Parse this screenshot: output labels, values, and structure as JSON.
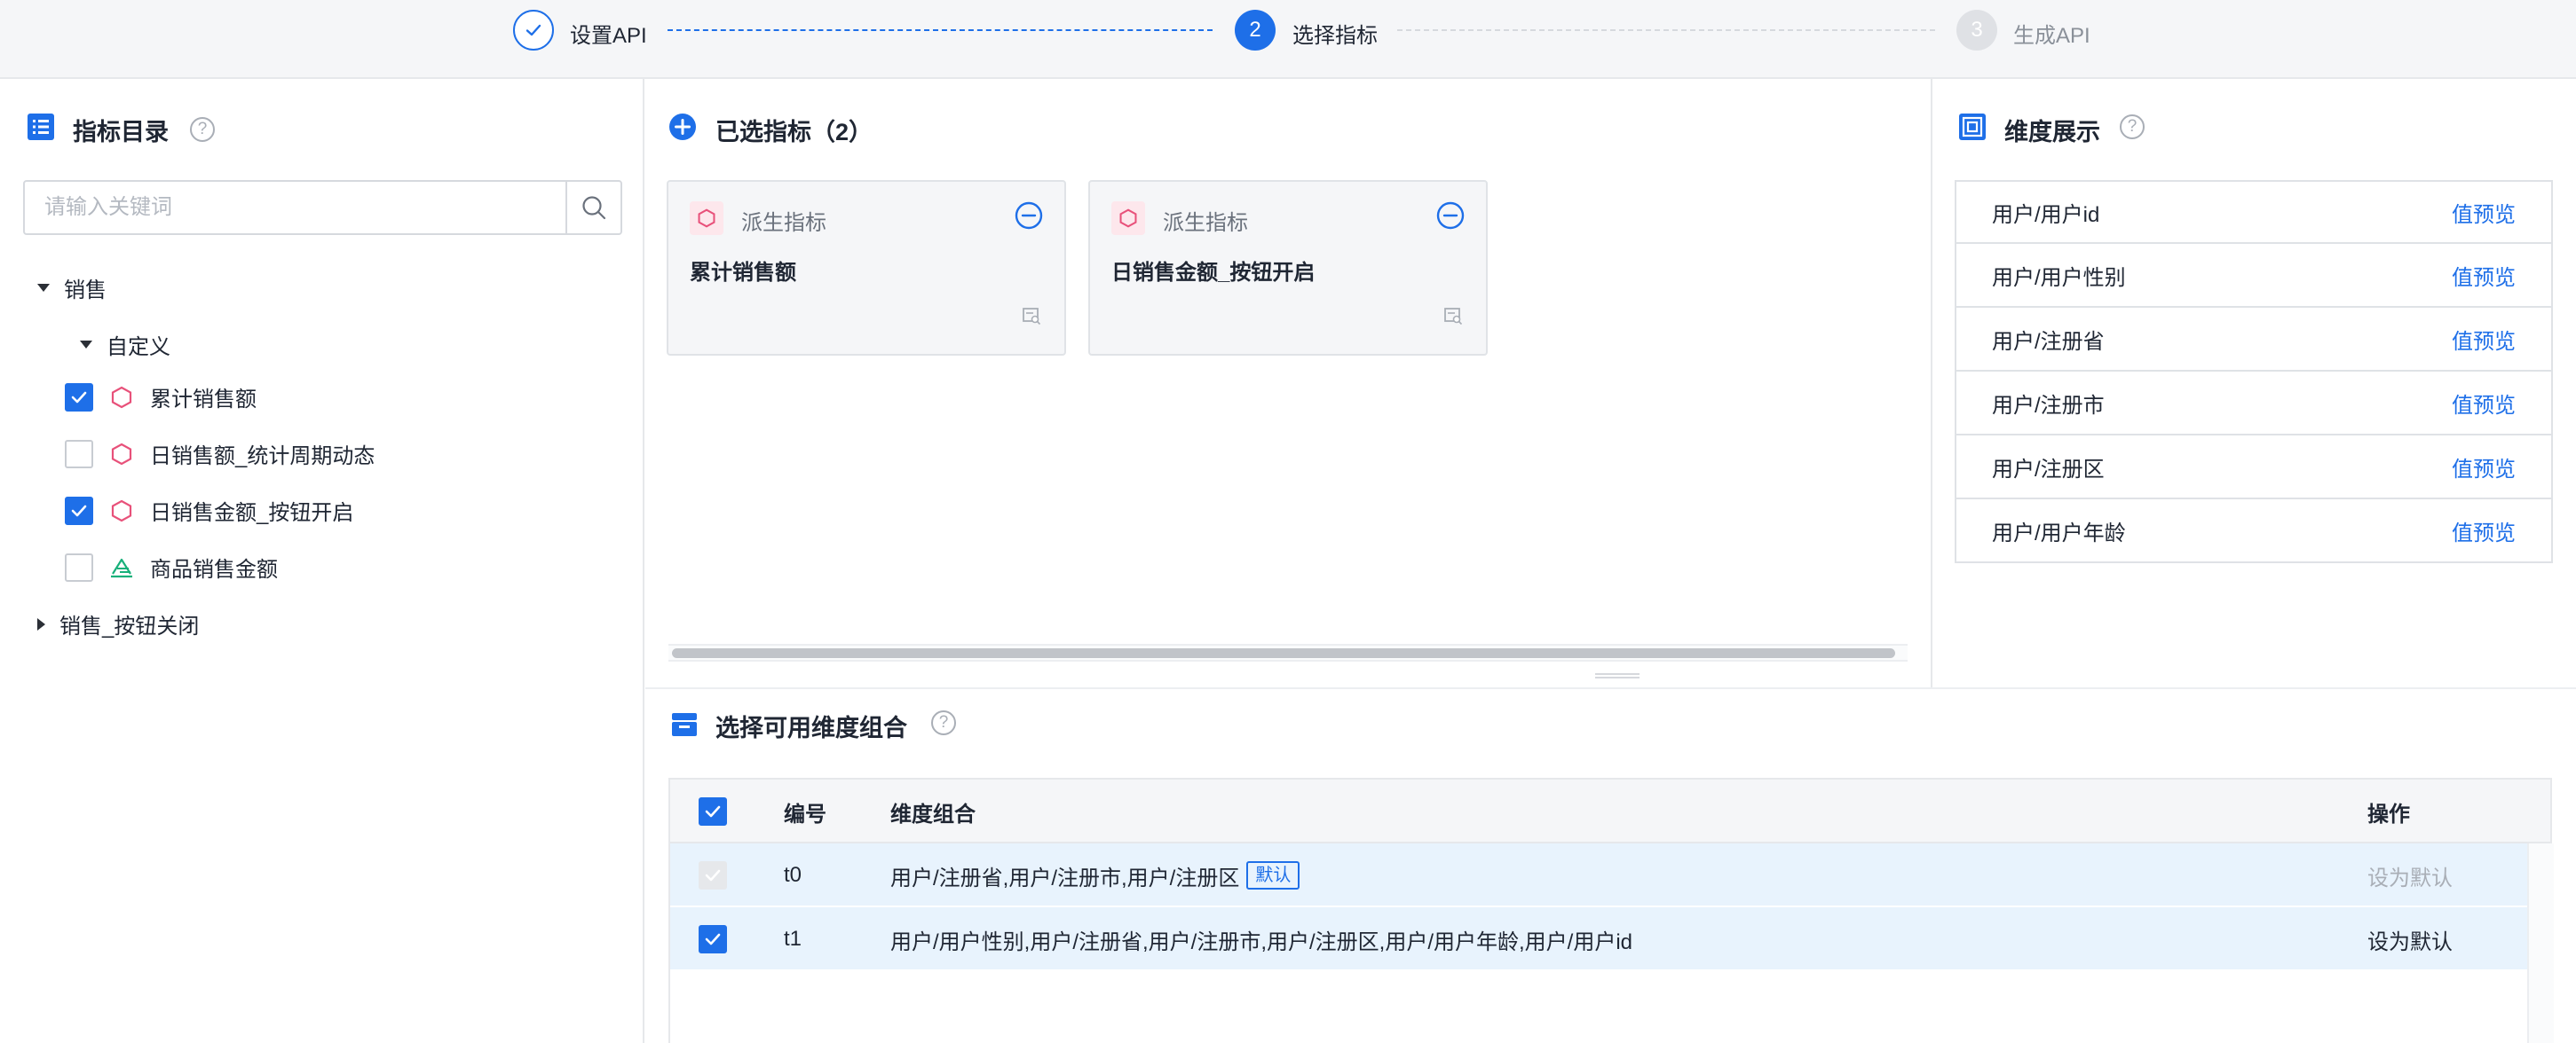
{
  "stepper": {
    "steps": [
      {
        "label": "设置API",
        "status": "done"
      },
      {
        "label": "选择指标",
        "number": "2",
        "status": "active"
      },
      {
        "label": "生成API",
        "number": "3",
        "status": "pending"
      }
    ]
  },
  "catalog": {
    "title": "指标目录",
    "search_placeholder": "请输入关键词",
    "tree": {
      "group1": "销售",
      "subgroup1": "自定义",
      "items": [
        {
          "label": "累计销售额",
          "checked": true,
          "icon": "derived-metric-icon"
        },
        {
          "label": "日销售额_统计周期动态",
          "checked": false,
          "icon": "derived-metric-icon"
        },
        {
          "label": "日销售金额_按钮开启",
          "checked": true,
          "icon": "derived-metric-icon"
        },
        {
          "label": "商品销售金额",
          "checked": false,
          "icon": "atomic-metric-icon"
        }
      ],
      "group2": "销售_按钮关闭"
    }
  },
  "selected": {
    "title": "已选指标（2）",
    "cards": [
      {
        "type": "派生指标",
        "name": "累计销售额"
      },
      {
        "type": "派生指标",
        "name": "日销售金额_按钮开启"
      }
    ]
  },
  "dimensions": {
    "title": "维度展示",
    "preview_label": "值预览",
    "items": [
      "用户/用户id",
      "用户/用户性别",
      "用户/注册省",
      "用户/注册市",
      "用户/注册区",
      "用户/用户年龄"
    ]
  },
  "combos": {
    "title": "选择可用维度组合",
    "columns": {
      "id": "编号",
      "combo": "维度组合",
      "action": "操作"
    },
    "default_tag": "默认",
    "rows": [
      {
        "id": "t0",
        "combo": "用户/注册省,用户/注册市,用户/注册区",
        "is_default": true,
        "action": "设为默认"
      },
      {
        "id": "t1",
        "combo": "用户/用户性别,用户/注册省,用户/注册市,用户/注册区,用户/用户年龄,用户/用户id",
        "is_default": false,
        "action": "设为默认"
      }
    ]
  },
  "colors": {
    "primary": "#1e6fe8",
    "derived_metric": "#e8517a",
    "atomic_metric": "#18b07a",
    "row_highlight": "#e8f3fd"
  }
}
